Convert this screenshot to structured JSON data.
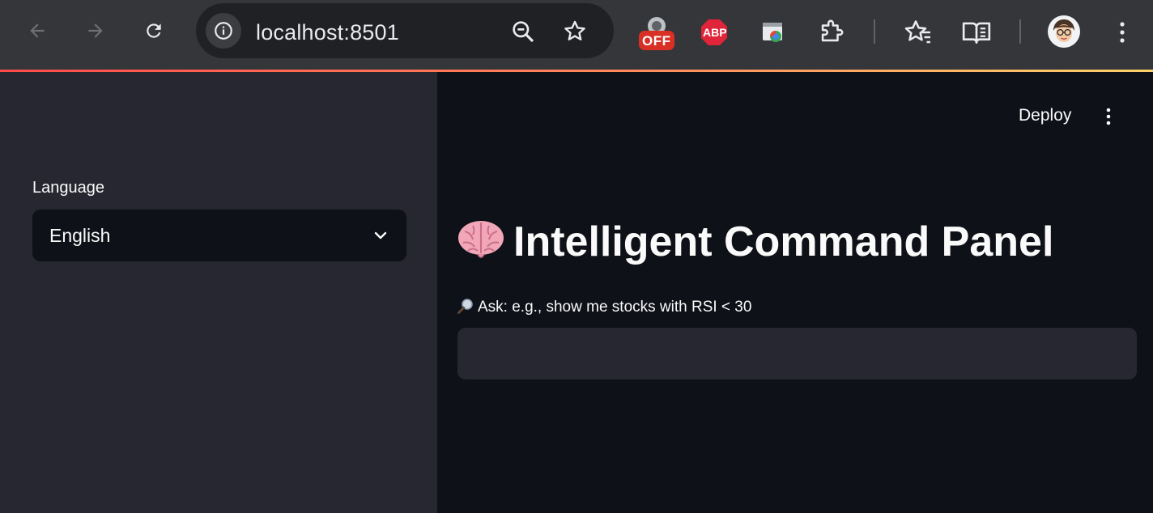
{
  "browser": {
    "url": "localhost:8501",
    "extensions": {
      "off_badge": "OFF",
      "abp_badge": "ABP"
    }
  },
  "sidebar": {
    "language_label": "Language",
    "language_value": "English"
  },
  "header": {
    "deploy_label": "Deploy"
  },
  "main": {
    "title": "Intelligent Command Panel",
    "ask_label": "Ask: e.g., show me stocks with RSI < 30",
    "ask_value": ""
  },
  "colors": {
    "app_bg": "#0e1117",
    "sidebar_bg": "#262730",
    "text": "#fafafa",
    "accent": "#ff4b4b"
  }
}
